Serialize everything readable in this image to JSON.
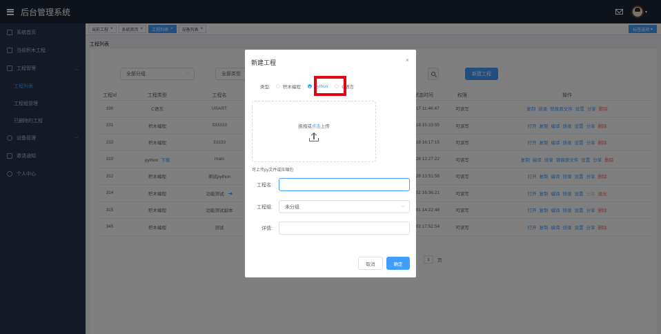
{
  "app": {
    "title": "后台管理系统"
  },
  "colors": {
    "primary": "#409eff",
    "danger": "#f56c6c",
    "topbar": "#1d2637",
    "sidebar": "#27324a",
    "highlight": "#e60012"
  },
  "sidebar": {
    "items": [
      {
        "label": "系统首页",
        "icon": "home-icon"
      },
      {
        "label": "当前积木工程",
        "icon": "document-icon"
      },
      {
        "label": "工程管理",
        "icon": "folder-icon"
      },
      {
        "label": "设备管理",
        "icon": "settings-icon"
      },
      {
        "label": "邀请通知",
        "icon": "mail-icon"
      },
      {
        "label": "个人中心",
        "icon": "user-icon"
      }
    ],
    "project_sub": [
      "工程列表",
      "工程组管理",
      "已删除的工程"
    ]
  },
  "tabs": [
    {
      "label": "当前工程"
    },
    {
      "label": "系统首页"
    },
    {
      "label": "工程列表"
    },
    {
      "label": "设备列表"
    }
  ],
  "tabs_ops_label": "标签选项",
  "breadcrumb": "工程列表",
  "filters": {
    "group_select": "全部分组",
    "type_select": "全部类型",
    "new_button": "新建工程"
  },
  "table": {
    "headers": [
      "工程Id",
      "工程类型",
      "工程名",
      "",
      "状态时间",
      "权限",
      "操作"
    ],
    "rows": [
      {
        "id": "190",
        "type": "C语言",
        "name": "USART",
        "time": "-12-17 11:46:47",
        "perm": "可读写",
        "ops": [
          "复制",
          "烧录",
          "替换原文件",
          "设置",
          "分享",
          "删除"
        ]
      },
      {
        "id": "231",
        "type": "积木编程",
        "name": "333333",
        "time": "-12-18 15:33:55",
        "perm": "可读写",
        "ops": [
          "打开",
          "复制",
          "编译",
          "烧录",
          "设置",
          "分享",
          "删除"
        ]
      },
      {
        "id": "232",
        "type": "积木编程",
        "name": "33333",
        "time": "-12-18 16:17:15",
        "perm": "可读写",
        "ops": [
          "打开",
          "复制",
          "编译",
          "烧录",
          "设置",
          "分享",
          "删除"
        ]
      },
      {
        "id": "310",
        "type": "python",
        "type_link": "下载",
        "name": "main",
        "time": "-12-28 13:27:22",
        "perm": "可读写",
        "ops": [
          "复制",
          "编译",
          "烧录",
          "替换原文件",
          "设置",
          "分享",
          "删除"
        ]
      },
      {
        "id": "312",
        "type": "积木编程",
        "name": "测试python",
        "time": "-12-28 13:51:56",
        "perm": "可读写",
        "ops": [
          "打开",
          "复制",
          "编译",
          "烧录",
          "设置",
          "分享",
          "删除"
        ]
      },
      {
        "id": "314",
        "type": "积木编程",
        "name": "功能测试",
        "time": "-01-02 16:36:21",
        "perm": "可读写",
        "ops": [
          "打开",
          "复制",
          "编译",
          "烧录",
          "设置",
          "分享",
          "退出"
        ]
      },
      {
        "id": "315",
        "type": "积木编程",
        "name": "功能测试副本",
        "time": "-01-01 14:22:48",
        "perm": "可读写",
        "ops": [
          "打开",
          "复制",
          "编译",
          "烧录",
          "设置",
          "分享",
          "删除"
        ]
      },
      {
        "id": "345",
        "type": "积木编程",
        "name": "测试",
        "time": "-01-02 17:52:54",
        "perm": "可读写",
        "ops": [
          "打开",
          "复制",
          "编译",
          "烧录",
          "设置",
          "分享",
          "删除"
        ]
      }
    ]
  },
  "pager": {
    "current": "1",
    "suffix": "页"
  },
  "dialog": {
    "title": "新建工程",
    "type_label": "类型:",
    "radios": [
      "积木编程",
      "python",
      "C语言"
    ],
    "selected": "python",
    "upload_text": "拖拽或",
    "upload_link": "点击",
    "upload_text2": "上传",
    "upload_tip": "可上传py文件或压缩包",
    "name_label": "工程名:",
    "name_value": "",
    "group_label": "工程组:",
    "group_value": "未分组",
    "detail_label": "详情:",
    "detail_value": "",
    "cancel": "取消",
    "ok": "确定"
  }
}
